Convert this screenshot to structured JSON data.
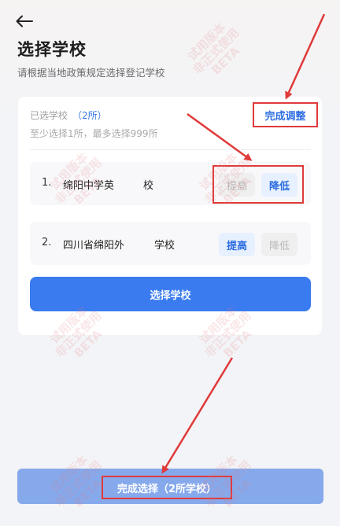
{
  "header": {
    "back_icon": "arrow-left-icon",
    "title": "选择学校",
    "subtitle": "请根据当地政策规定选择登记学校"
  },
  "selection": {
    "selected_label": "已选学校",
    "selected_count": "（2所）",
    "limit_text": "至少选择1所，最多选择999所",
    "finish_adjust_label": "完成调整"
  },
  "schools": [
    {
      "index": "1.",
      "name": "绵阳中学英",
      "suffix": "校",
      "raise_label": "提高",
      "lower_label": "降低",
      "raise_enabled": false,
      "lower_enabled": true
    },
    {
      "index": "2.",
      "name": "四川省绵阳外",
      "suffix": "学校",
      "raise_label": "提高",
      "lower_label": "降低",
      "raise_enabled": true,
      "lower_enabled": false
    }
  ],
  "actions": {
    "select_school_label": "选择学校",
    "finish_select_label": "完成选择（2所学校）"
  },
  "watermark": {
    "line1": "试用版本",
    "line2": "非正式使用",
    "line3": "BETA"
  },
  "colors": {
    "primary": "#3a7bf0",
    "primary_disabled": "#86a9ec",
    "link": "#2f6fe0",
    "annotation": "#e03a3a",
    "disabled_pill_bg": "#efefef",
    "active_pill_bg": "#e6f0ff"
  }
}
